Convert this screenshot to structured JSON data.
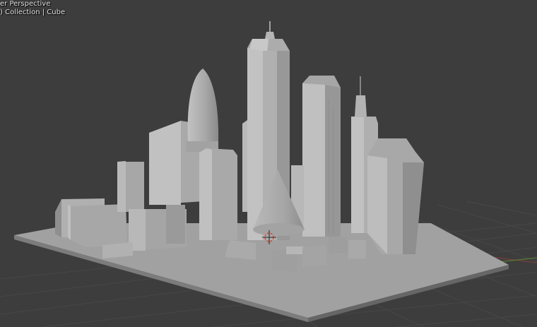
{
  "viewport": {
    "view_name": "er Perspective",
    "collection_info": ") Collection | Cube"
  },
  "scene": {
    "background_color": "#3d3d3d",
    "grid_color": "#474747",
    "axis_x_color": "#7a3d3d",
    "axis_y_color": "#5a7a33",
    "model_color": "#a3a3a3",
    "objects": [
      "ground-plane",
      "gherkin-tower",
      "spire-tower",
      "cone-building",
      "3d-cursor"
    ]
  }
}
